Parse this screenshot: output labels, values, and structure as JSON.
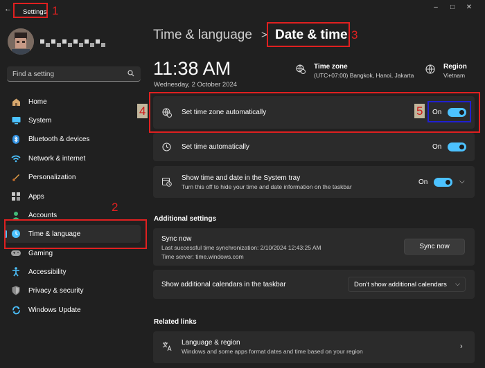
{
  "window": {
    "title": "Settings",
    "minimize": "–",
    "maximize": "□",
    "close": "✕"
  },
  "search": {
    "placeholder": "Find a setting"
  },
  "nav": [
    {
      "label": "Home",
      "icon": "home-icon"
    },
    {
      "label": "System",
      "icon": "system-icon"
    },
    {
      "label": "Bluetooth & devices",
      "icon": "bluetooth-icon"
    },
    {
      "label": "Network & internet",
      "icon": "network-icon"
    },
    {
      "label": "Personalization",
      "icon": "personalization-icon"
    },
    {
      "label": "Apps",
      "icon": "apps-icon"
    },
    {
      "label": "Accounts",
      "icon": "accounts-icon"
    },
    {
      "label": "Time & language",
      "icon": "time-language-icon",
      "active": true
    },
    {
      "label": "Gaming",
      "icon": "gaming-icon"
    },
    {
      "label": "Accessibility",
      "icon": "accessibility-icon"
    },
    {
      "label": "Privacy & security",
      "icon": "privacy-icon"
    },
    {
      "label": "Windows Update",
      "icon": "windows-update-icon"
    }
  ],
  "breadcrumb": {
    "parent": "Time & language",
    "separator": ">",
    "current": "Date & time"
  },
  "clock": {
    "time": "11:38 AM",
    "date": "Wednesday, 2 October 2024"
  },
  "timezone": {
    "label": "Time zone",
    "value": "(UTC+07:00) Bangkok, Hanoi, Jakarta"
  },
  "region": {
    "label": "Region",
    "value": "Vietnam"
  },
  "settings": {
    "tz_auto": {
      "title": "Set time zone automatically",
      "state": "On"
    },
    "time_auto": {
      "title": "Set time automatically",
      "state": "On"
    },
    "tray": {
      "title": "Show time and date in the System tray",
      "subtitle": "Turn this off to hide your time and date information on the taskbar",
      "state": "On"
    }
  },
  "additional": {
    "heading": "Additional settings",
    "sync": {
      "title": "Sync now",
      "last": "Last successful time synchronization: 2/10/2024 12:43:25 AM",
      "server": "Time server: time.windows.com",
      "button": "Sync now"
    },
    "calendars": {
      "title": "Show additional calendars in the taskbar",
      "value": "Don't show additional calendars"
    }
  },
  "related": {
    "heading": "Related links",
    "language": {
      "title": "Language & region",
      "subtitle": "Windows and some apps format dates and time based on your region"
    }
  },
  "annotations": [
    "1",
    "2",
    "3",
    "4",
    "5"
  ],
  "colors": {
    "accent": "#4cc2ff",
    "highlight_red": "#e02020",
    "highlight_blue": "#2020d0",
    "background": "#202020",
    "card": "#2b2b2b"
  }
}
